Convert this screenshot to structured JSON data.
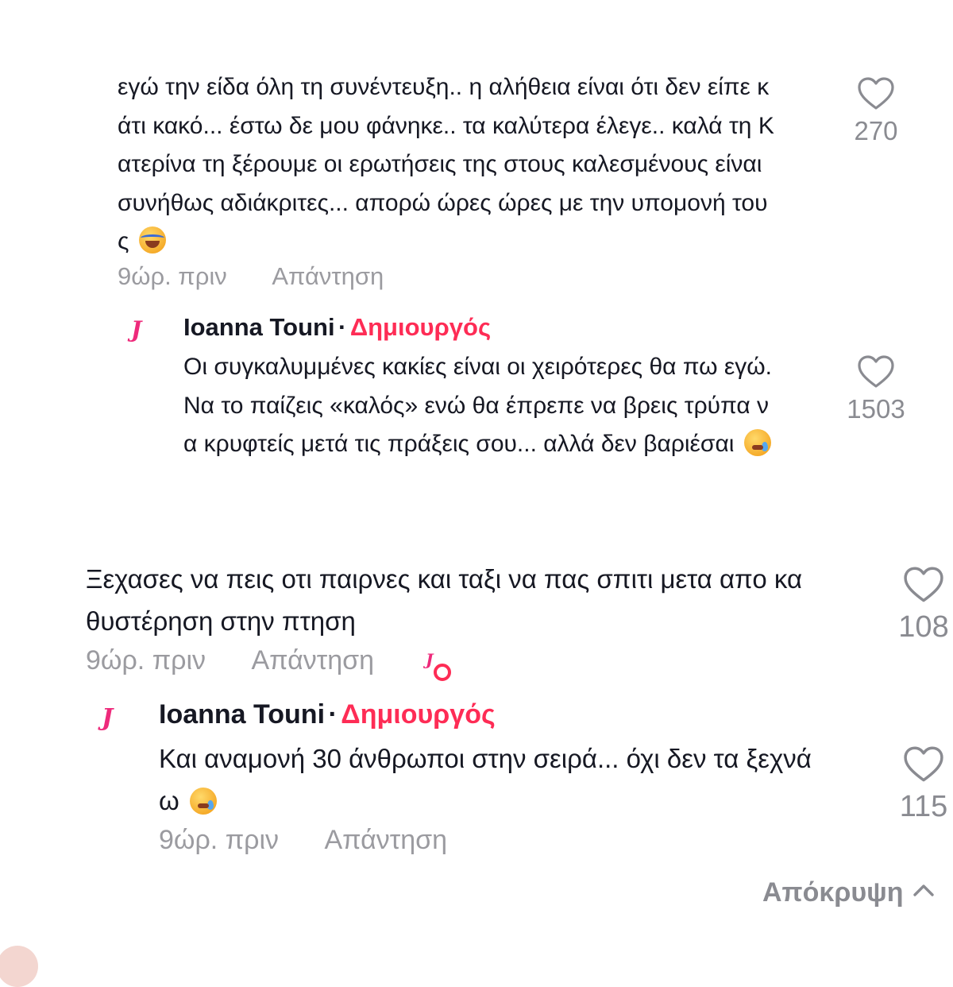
{
  "comments": [
    {
      "lines": [
        "εγώ την είδα όλη τη συνέντευξη.. η αλήθεια είναι ότι δεν είπε κ",
        "άτι κακό... έστω δε μου φάνηκε.. τα καλύτερα έλεγε.. καλά τη Κ",
        "ατερίνα τη ξέρουμε οι ερωτήσεις της στους καλεσμένους είναι",
        "συνήθως αδιάκριτες... απορώ ώρες ώρες με την υπομονή του",
        "ς"
      ],
      "emoji": "face-with-tears-of-joy",
      "time": "9ώρ. πριν",
      "reply_label": "Απάντηση",
      "likes": "270"
    },
    {
      "author": "Ioanna Touni",
      "separator": "·",
      "badge": "Δημιουργός",
      "avatar_letter": "J",
      "lines": [
        "Οι συγκαλυμμένες κακίες είναι οι χειρότερες θα πω εγώ.",
        "Να το παίζεις «καλός» ενώ θα έπρεπε να βρεις τρύπα ν",
        "α κρυφτείς μετά τις πράξεις σου... αλλά δεν βαριέσαι"
      ],
      "emoji": "face-holding-back-tears",
      "likes": "1503"
    },
    {
      "lines": [
        "Ξεχασες να πεις οτι παιρνες και ταξι να πας σπιτι μετα απο κα",
        "θυστέρηση στην πτηση"
      ],
      "time": "9ώρ. πριν",
      "reply_label": "Απάντηση",
      "liked_by_creator_letter": "J",
      "likes": "108"
    },
    {
      "author": "Ioanna Touni",
      "separator": "·",
      "badge": "Δημιουργός",
      "avatar_letter": "J",
      "lines": [
        "Και αναμονή 30 άνθρωποι στην σειρά... όχι δεν τα ξεχνά",
        "ω"
      ],
      "emoji": "face-holding-back-tears",
      "time": "9ώρ. πριν",
      "reply_label": "Απάντηση",
      "likes": "115"
    }
  ],
  "hide_replies_label": "Απόκρυψη",
  "icons": {
    "like": "heart-outline-icon",
    "collapse": "chevron-up-icon"
  },
  "colors": {
    "text": "#161823",
    "muted": "#9b9ba0",
    "creator_badge": "#fe2c55",
    "avatar_logo": "#ee2a7b"
  }
}
